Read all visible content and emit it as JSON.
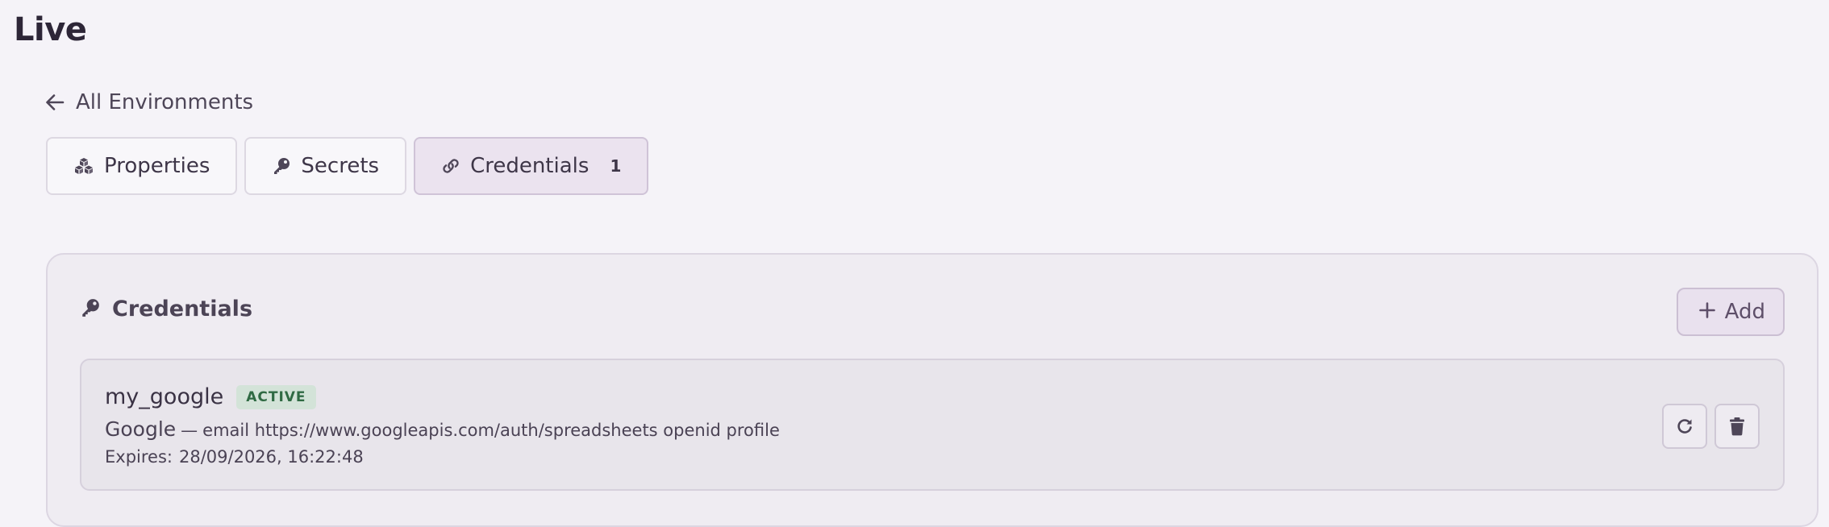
{
  "page": {
    "title": "Live"
  },
  "navigation": {
    "back_label": "All Environments",
    "back_icon": "arrow-left-icon"
  },
  "tabs": [
    {
      "label": "Properties",
      "icon": "cubes-icon",
      "active": false
    },
    {
      "label": "Secrets",
      "icon": "key-icon",
      "active": false
    },
    {
      "label": "Credentials",
      "icon": "link-icon",
      "active": true,
      "count": "1"
    }
  ],
  "credentials_panel": {
    "title": "Credentials",
    "title_icon": "key-icon",
    "add_label": "Add",
    "add_icon": "plus-icon",
    "items": [
      {
        "name": "my_google",
        "status": "ACTIVE",
        "provider": "Google",
        "separator": "—",
        "scopes": "email https://www.googleapis.com/auth/spreadsheets openid profile",
        "expires_label": "Expires:",
        "expires_value": "28/09/2026, 16:22:48",
        "actions": [
          {
            "name": "refresh",
            "icon": "refresh-icon"
          },
          {
            "name": "delete",
            "icon": "trash-icon"
          }
        ]
      }
    ]
  },
  "colors": {
    "background": "#f5f3f8",
    "panel": "#efecf2",
    "active_tab": "#ebe3ef",
    "accent": "#5e4f69",
    "status_active_bg": "#d3e3d8",
    "status_active_text": "#2f6a43"
  }
}
